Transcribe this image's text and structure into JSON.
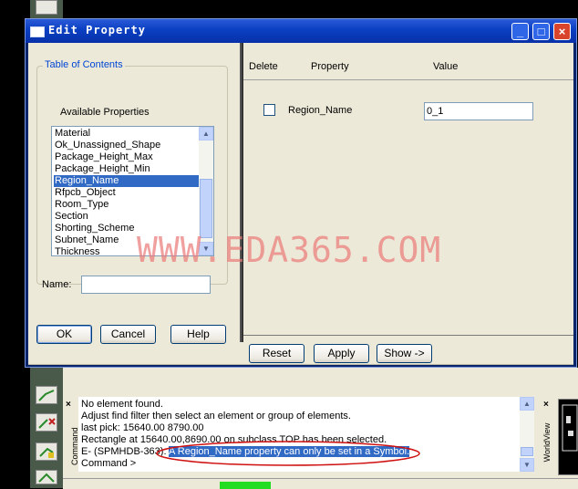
{
  "dialog": {
    "title": "Edit Property",
    "toc": {
      "legend": "Table of Contents",
      "available_label": "Available Properties",
      "items": [
        "Material",
        "Ok_Unassigned_Shape",
        "Package_Height_Max",
        "Package_Height_Min",
        "Region_Name",
        "Rfpcb_Object",
        "Room_Type",
        "Section",
        "Shorting_Scheme",
        "Subnet_Name",
        "Thickness"
      ],
      "selected": "Region_Name",
      "name_label": "Name:",
      "name_value": ""
    },
    "grid": {
      "headers": {
        "delete": "Delete",
        "property": "Property",
        "value": "Value"
      },
      "rows": [
        {
          "property": "Region_Name",
          "value": "0_1",
          "checked": false
        }
      ]
    },
    "buttons": {
      "ok": "OK",
      "cancel": "Cancel",
      "help": "Help",
      "reset": "Reset",
      "apply": "Apply",
      "show": "Show ->"
    }
  },
  "command_window": {
    "tab_label": "Command",
    "lines": [
      "No element found.",
      "Adjust find filter then select an element or group of elements.",
      "last pick:  15640.00  8790.00",
      "Rectangle at 15640.00,8690.00 on subclass TOP has been selected."
    ],
    "error_prefix": "E- (SPMHDB-363):",
    "error_message": "A Region_Name property can only be set in a Symbol.",
    "prompt": "Command >"
  },
  "worldview": {
    "tab_label": "WorldView"
  },
  "watermark": "WWW.EDA365.COM",
  "colors": {
    "titlebar": "#0a3fc2",
    "selection": "#316ac5",
    "dialog_bg": "#ece9d8",
    "annotation": "#d01010"
  }
}
